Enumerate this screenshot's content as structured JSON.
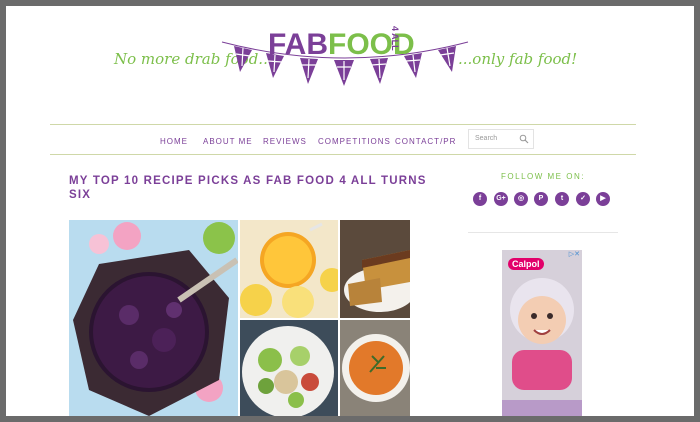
{
  "header": {
    "logo_main": "FAB",
    "logo_food": "FOOD",
    "logo_suffix": "4 ALL",
    "tagline_left": "No more drab food...",
    "tagline_right": "...only fab food!"
  },
  "nav": {
    "items": [
      {
        "label": "HOME"
      },
      {
        "label": "ABOUT ME"
      },
      {
        "label": "REVIEWS"
      },
      {
        "label": "COMPETITIONS"
      },
      {
        "label": "CONTACT/PR"
      }
    ],
    "search_placeholder": "Search"
  },
  "post": {
    "title": "MY TOP 10 RECIPE PICKS AS FAB FOOD 4 ALL TURNS SIX"
  },
  "sidebar": {
    "follow_label": "FOLLOW ME ON:",
    "social": [
      {
        "icon": "facebook-icon",
        "glyph": "f"
      },
      {
        "icon": "google-plus-icon",
        "glyph": "G+"
      },
      {
        "icon": "instagram-icon",
        "glyph": "◎"
      },
      {
        "icon": "pinterest-icon",
        "glyph": "P"
      },
      {
        "icon": "tumblr-icon",
        "glyph": "t"
      },
      {
        "icon": "twitter-icon",
        "glyph": "✓"
      },
      {
        "icon": "youtube-icon",
        "glyph": "▶"
      }
    ],
    "ad_brand": "Calpol"
  },
  "colors": {
    "purple": "#7b3f98",
    "green": "#7cbf4a",
    "frame_grey": "#6b6b6b"
  }
}
